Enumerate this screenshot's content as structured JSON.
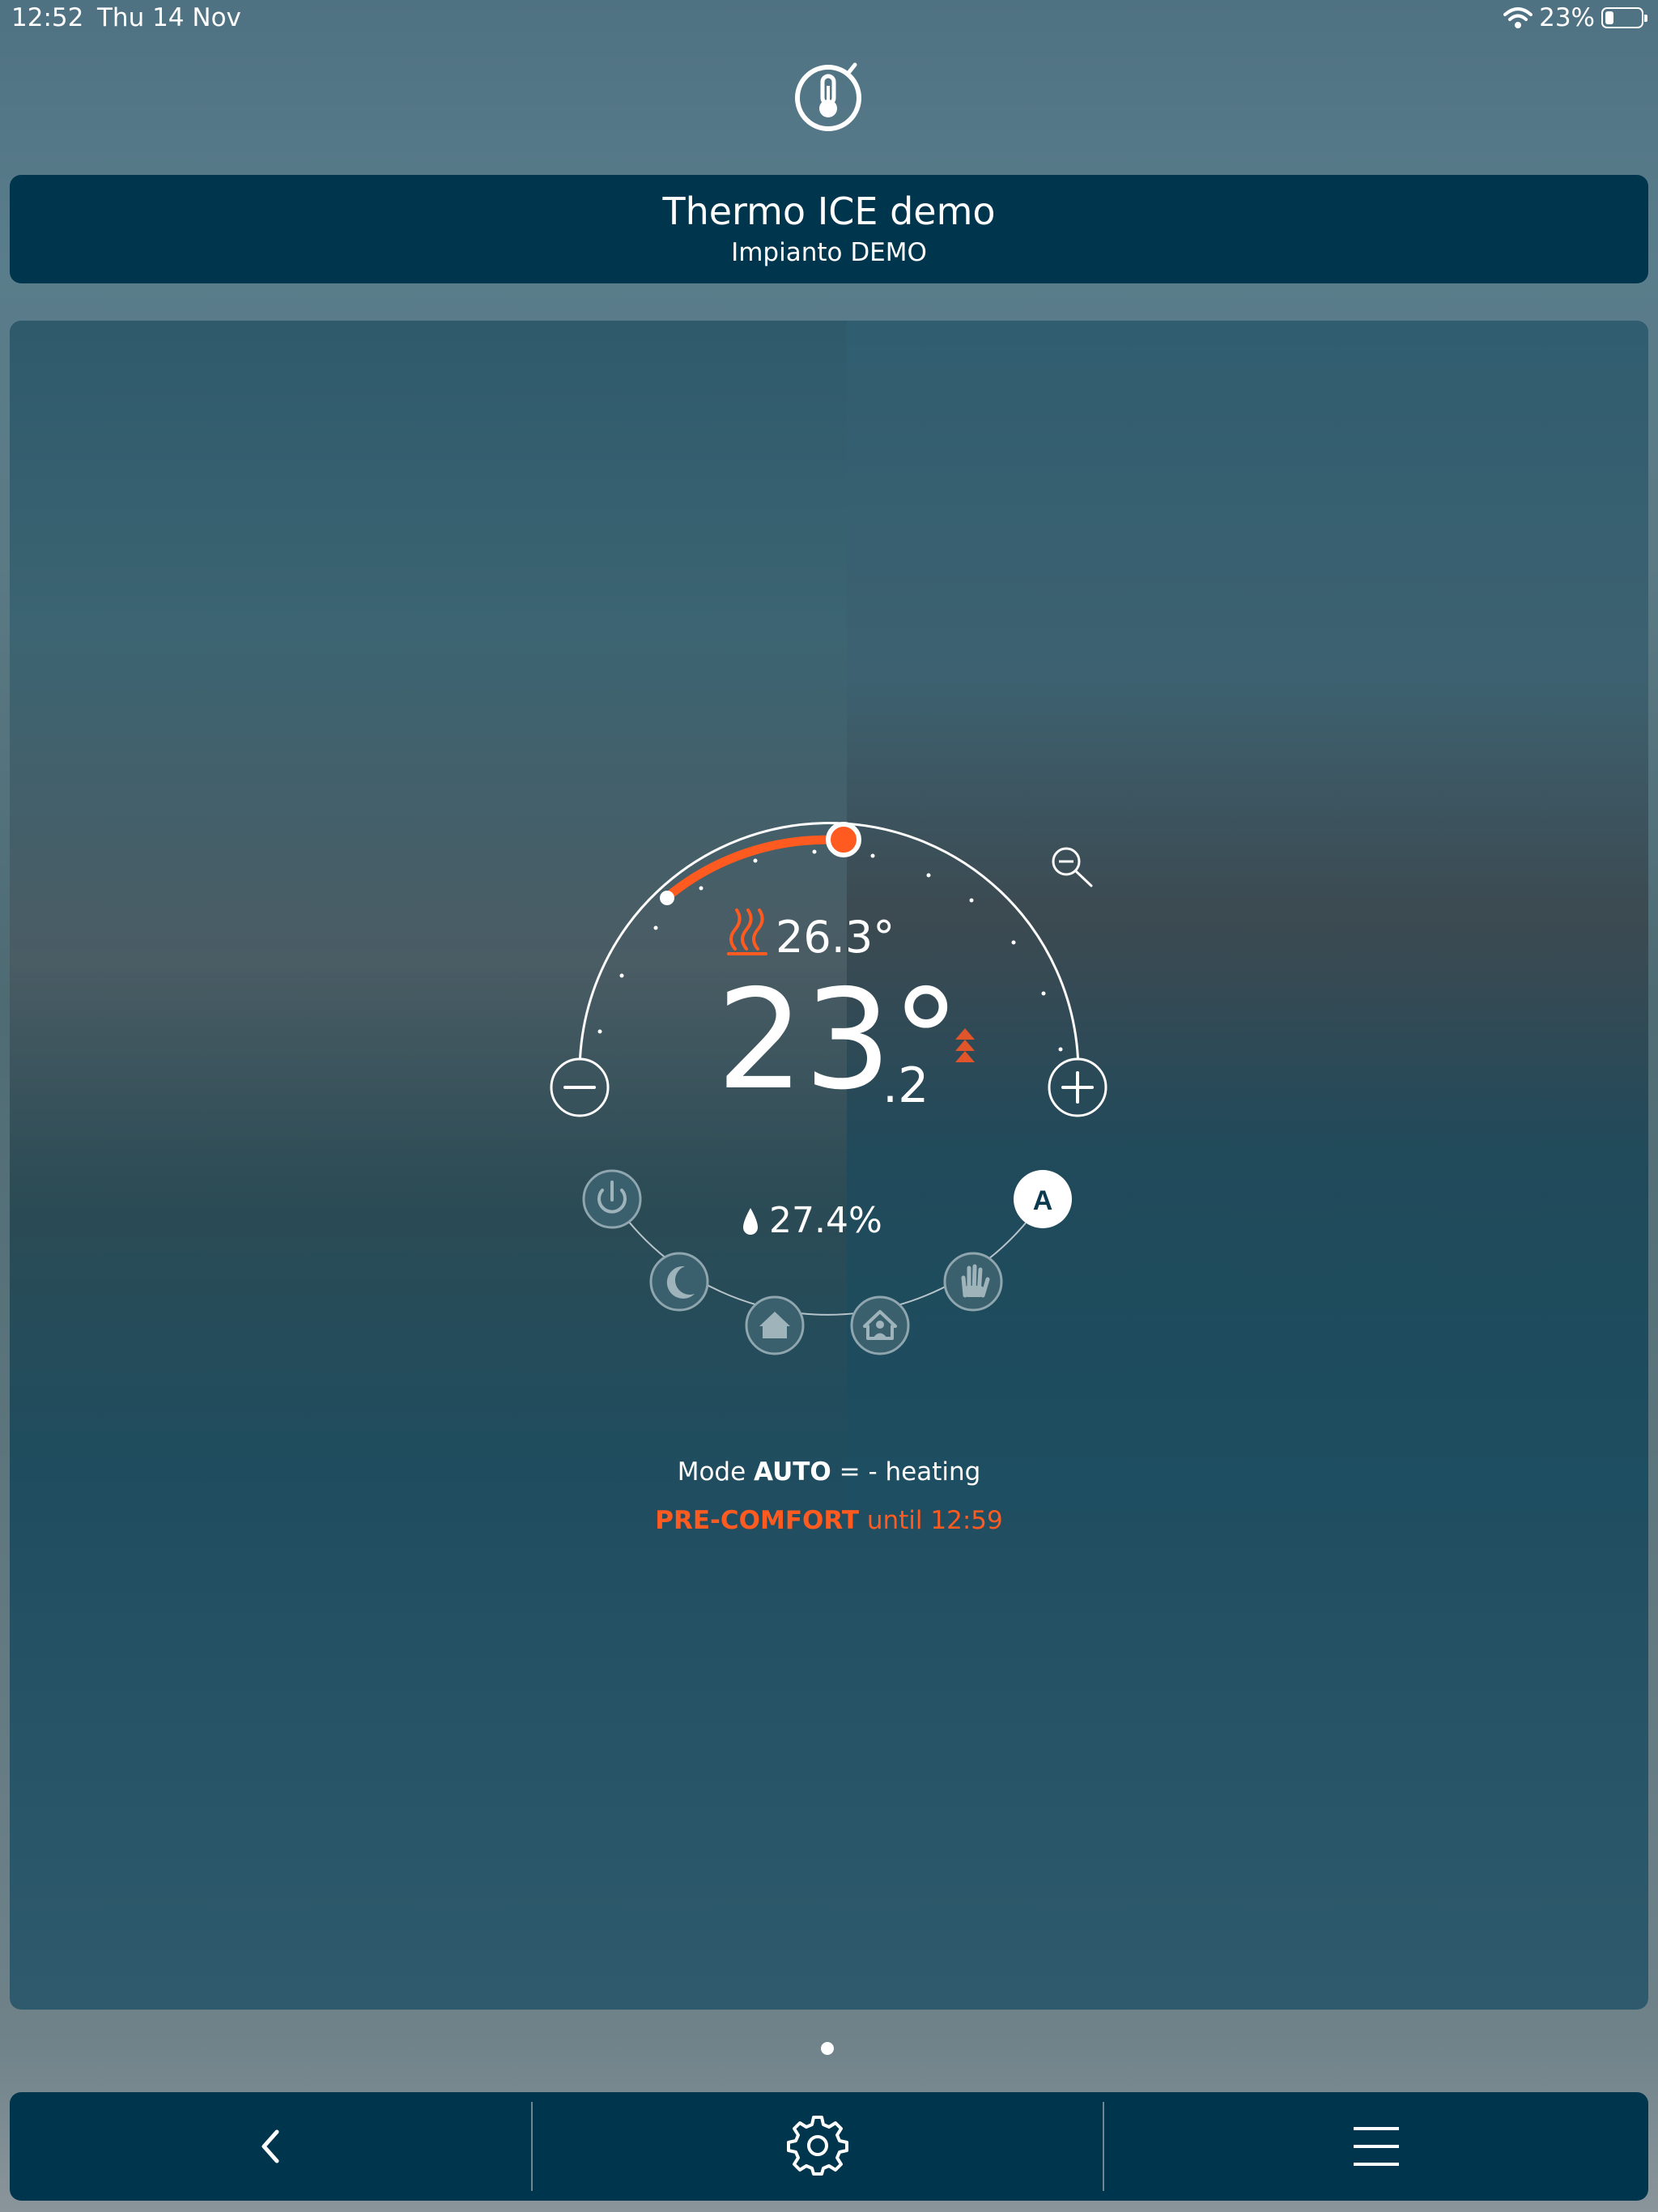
{
  "status_bar": {
    "time": "12:52",
    "date": "Thu 14 Nov",
    "battery": "23%",
    "battery_level": 0.23
  },
  "header": {
    "title": "Thermo ICE demo",
    "subtitle": "Impianto DEMO"
  },
  "thermostat": {
    "heating_temp": "26.3°",
    "current_temp_int": "23°",
    "current_temp_dec": ".2",
    "humidity": "27.4%",
    "auto_label": "A",
    "modes": [
      "power",
      "night",
      "home",
      "presence",
      "manual",
      "auto"
    ],
    "active_mode": "auto"
  },
  "mode_status": {
    "mode_prefix": "Mode",
    "mode_value": "AUTO",
    "mode_suffix": "= - heating"
  },
  "comfort_status": {
    "state": "PRE-COMFORT",
    "until": "until 12:59"
  },
  "pager": {
    "pages": 1,
    "current": 1
  },
  "colors": {
    "accent": "#ff5a1f",
    "bar": "#00364d"
  },
  "icons": {
    "app": "thermometer-icon",
    "zoom": "zoom-out-icon",
    "back": "chevron-left-icon",
    "settings": "gear-icon",
    "menu": "hamburger-menu-icon"
  }
}
